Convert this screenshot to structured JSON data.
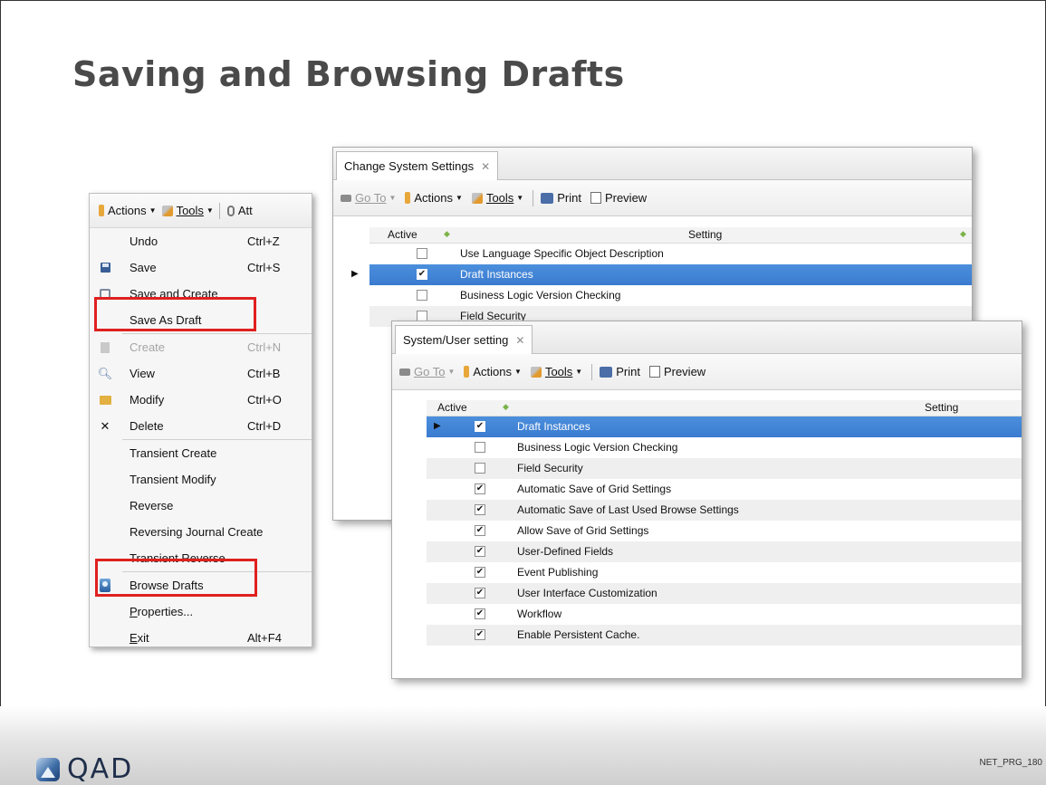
{
  "slide": {
    "title": "Saving and Browsing Drafts",
    "logo_text": "QAD",
    "code": "NET_PRG_180"
  },
  "actions_menu": {
    "toolbar": {
      "actions": "Actions",
      "tools": "Tools",
      "attach": "Att"
    },
    "items": [
      {
        "label": "Undo",
        "shortcut": "Ctrl+Z",
        "icon": "none",
        "disabled": false
      },
      {
        "label": "Save",
        "shortcut": "Ctrl+S",
        "icon": "floppy-icon",
        "disabled": false
      },
      {
        "label": "Save and Create",
        "shortcut": "",
        "icon": "save-create-icon",
        "disabled": false
      },
      {
        "label": "Save As Draft",
        "shortcut": "",
        "icon": "none",
        "disabled": false
      },
      {
        "label": "Create",
        "shortcut": "Ctrl+N",
        "icon": "create-icon",
        "disabled": true
      },
      {
        "label": "View",
        "shortcut": "Ctrl+B",
        "icon": "magnifier-icon",
        "disabled": false
      },
      {
        "label": "Modify",
        "shortcut": "Ctrl+O",
        "icon": "folder-icon",
        "disabled": false
      },
      {
        "label": "Delete",
        "shortcut": "Ctrl+D",
        "icon": "x-icon",
        "disabled": false
      },
      {
        "label": "Transient Create",
        "shortcut": "",
        "icon": "none",
        "disabled": false
      },
      {
        "label": "Transient Modify",
        "shortcut": "",
        "icon": "none",
        "disabled": false
      },
      {
        "label": "Reverse",
        "shortcut": "",
        "icon": "none",
        "disabled": false
      },
      {
        "label": "Reversing Journal Create",
        "shortcut": "",
        "icon": "none",
        "disabled": false
      },
      {
        "label": "Transient Reverse",
        "shortcut": "",
        "icon": "none",
        "disabled": false
      },
      {
        "label": "Browse Drafts",
        "shortcut": "",
        "icon": "browse-drafts-icon",
        "disabled": false
      },
      {
        "label": "Properties...",
        "shortcut": "",
        "icon": "none",
        "disabled": false
      },
      {
        "label": "Exit",
        "shortcut": "Alt+F4",
        "icon": "none",
        "disabled": false
      }
    ],
    "highlight_color": "#e02020"
  },
  "change_system_settings": {
    "tab_label": "Change System Settings",
    "tab_close": "✕",
    "toolbar": {
      "goto": "Go To",
      "actions": "Actions",
      "tools": "Tools",
      "print": "Print",
      "preview": "Preview"
    },
    "columns": {
      "active": "Active",
      "setting": "Setting"
    },
    "rows": [
      {
        "checked": false,
        "setting": "Use Language Specific Object Description",
        "selected": false
      },
      {
        "checked": true,
        "setting": "Draft Instances",
        "selected": true
      },
      {
        "checked": false,
        "setting": "Business Logic Version Checking",
        "selected": false
      },
      {
        "checked": false,
        "setting": "Field Security",
        "selected": false
      }
    ]
  },
  "system_user_setting": {
    "tab_label": "System/User setting",
    "tab_close": "✕",
    "toolbar": {
      "goto": "Go To",
      "actions": "Actions",
      "tools": "Tools",
      "print": "Print",
      "preview": "Preview"
    },
    "columns": {
      "active": "Active",
      "setting": "Setting"
    },
    "rows": [
      {
        "checked": true,
        "setting": "Draft Instances",
        "selected": true
      },
      {
        "checked": false,
        "setting": "Business Logic Version Checking",
        "selected": false
      },
      {
        "checked": false,
        "setting": "Field Security",
        "selected": false
      },
      {
        "checked": true,
        "setting": "Automatic Save of Grid Settings",
        "selected": false
      },
      {
        "checked": true,
        "setting": "Automatic Save of Last Used Browse Settings",
        "selected": false
      },
      {
        "checked": true,
        "setting": "Allow Save of Grid Settings",
        "selected": false
      },
      {
        "checked": true,
        "setting": "User-Defined Fields",
        "selected": false
      },
      {
        "checked": true,
        "setting": "Event Publishing",
        "selected": false
      },
      {
        "checked": true,
        "setting": "User Interface Customization",
        "selected": false
      },
      {
        "checked": true,
        "setting": "Workflow",
        "selected": false
      },
      {
        "checked": true,
        "setting": "Enable Persistent Cache.",
        "selected": false
      }
    ],
    "selection_color": "#3a7bd0"
  }
}
